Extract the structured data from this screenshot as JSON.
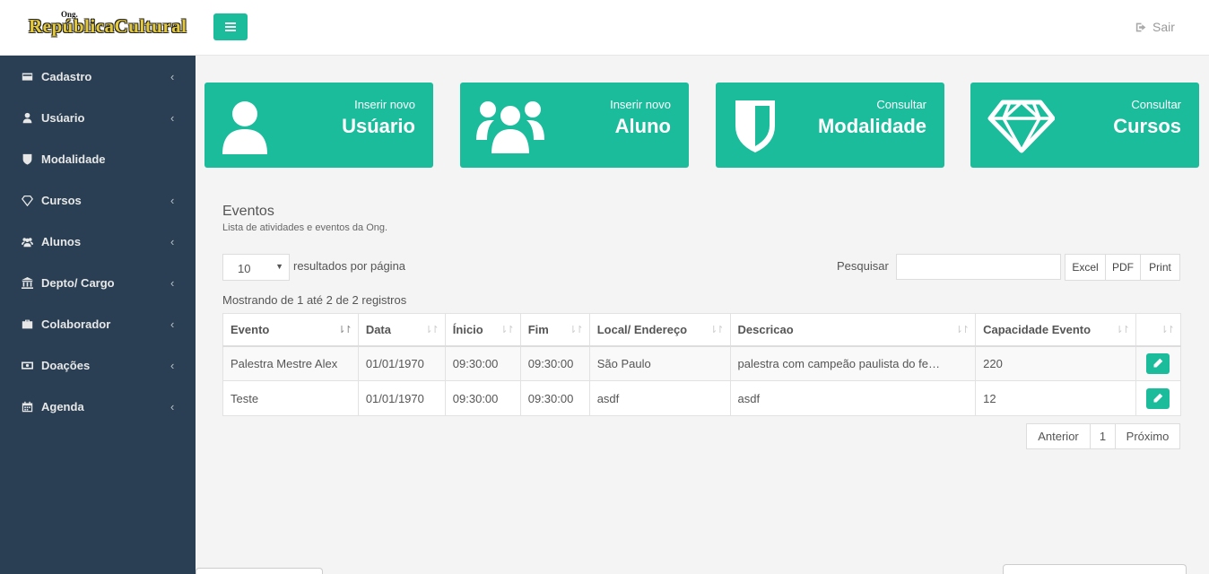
{
  "header": {
    "logo_small": "Ong.",
    "logo_name": "RepúblicaCultural",
    "logout_label": "Sair"
  },
  "sidebar": {
    "items": [
      {
        "label": "Cadastro",
        "icon": "card-icon",
        "has_chevron": true
      },
      {
        "label": "Usúario",
        "icon": "user-icon",
        "has_chevron": true
      },
      {
        "label": "Modalidade",
        "icon": "shield-icon",
        "has_chevron": false
      },
      {
        "label": "Cursos",
        "icon": "diamond-icon",
        "has_chevron": true
      },
      {
        "label": "Alunos",
        "icon": "users-icon",
        "has_chevron": true
      },
      {
        "label": "Depto/ Cargo",
        "icon": "bank-icon",
        "has_chevron": true
      },
      {
        "label": "Colaborador",
        "icon": "briefcase-icon",
        "has_chevron": true
      },
      {
        "label": "Doações",
        "icon": "money-icon",
        "has_chevron": true
      },
      {
        "label": "Agenda",
        "icon": "calendar-icon",
        "has_chevron": true
      }
    ]
  },
  "tiles": [
    {
      "small": "Inserir novo",
      "large": "Usúario",
      "icon": "user-icon"
    },
    {
      "small": "Inserir novo",
      "large": "Aluno",
      "icon": "users-icon"
    },
    {
      "small": "Consultar",
      "large": "Modalidade",
      "icon": "shield-icon"
    },
    {
      "small": "Consultar",
      "large": "Cursos",
      "icon": "diamond-icon"
    }
  ],
  "panel": {
    "title": "Eventos",
    "subtitle": "Lista de atividades e eventos da Ong."
  },
  "table_controls": {
    "page_length": "10",
    "page_length_label": "resultados por página",
    "search_label": "Pesquisar",
    "search_value": "",
    "export_buttons": [
      "Excel",
      "PDF",
      "Print"
    ],
    "info": "Mostrando de 1 até 2 de 2 registros"
  },
  "table": {
    "columns": [
      "Evento",
      "Data",
      "Ínicio",
      "Fim",
      "Local/ Endereço",
      "Descricao",
      "Capacidade Evento",
      ""
    ],
    "rows": [
      [
        "Palestra Mestre Alex",
        "01/01/1970",
        "09:30:00",
        "09:30:00",
        "São Paulo",
        "palestra com campeão paulista do fe…",
        "220"
      ],
      [
        "Teste",
        "01/01/1970",
        "09:30:00",
        "09:30:00",
        "asdf",
        "asdf",
        "12"
      ]
    ]
  },
  "pagination": {
    "prev": "Anterior",
    "current": "1",
    "next": "Próximo"
  },
  "colors": {
    "accent": "#1abc9c",
    "sidebar_bg": "#2a3f54",
    "content_bg": "#f4f4f4"
  }
}
